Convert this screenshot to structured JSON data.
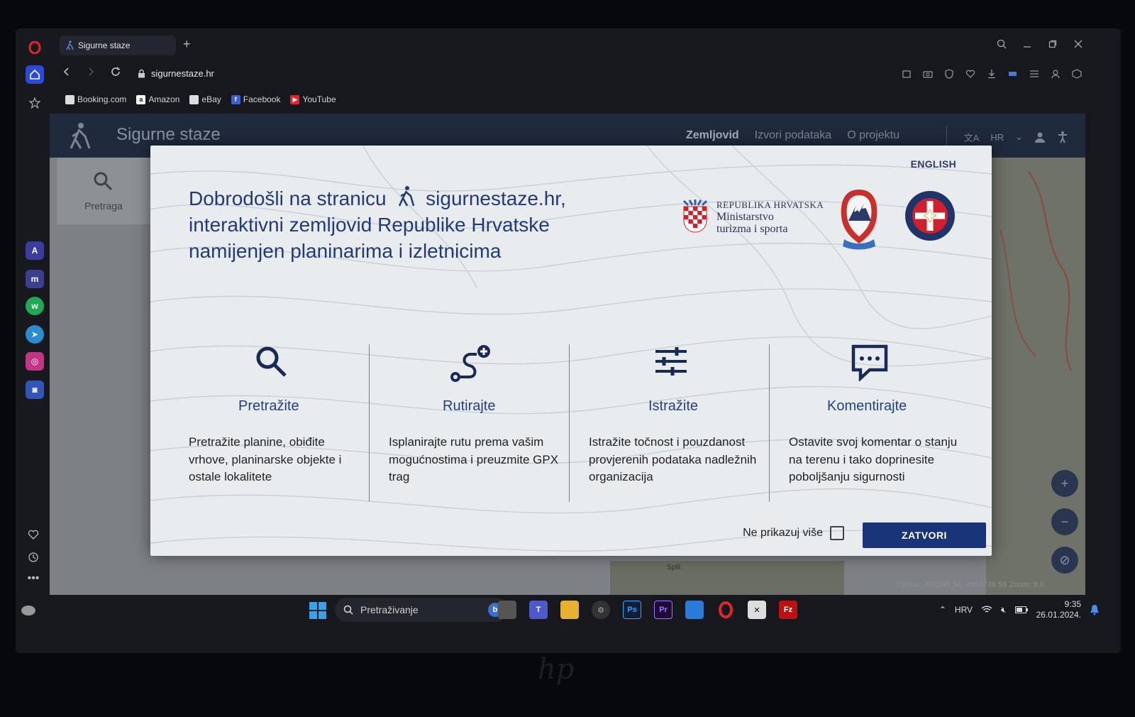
{
  "browser": {
    "tab_title": "Sigurne staze",
    "new_tab_label": "+",
    "url": "sigurnestaze.hr",
    "bookmarks": [
      {
        "label": "Booking.com",
        "icon": "page-icon"
      },
      {
        "label": "Amazon",
        "icon": "amazon-icon"
      },
      {
        "label": "eBay",
        "icon": "page-icon"
      },
      {
        "label": "Facebook",
        "icon": "facebook-icon"
      },
      {
        "label": "YouTube",
        "icon": "youtube-icon"
      }
    ]
  },
  "site": {
    "title": "Sigurne staze",
    "nav": [
      "Zemljovid",
      "Izvori podataka",
      "O projektu"
    ],
    "language": "HR",
    "left_panel_label": "Pretraga",
    "coords_text": "Centar: 495295.36, 4956738.59 Zoom: 8.0",
    "map_label": "Split"
  },
  "modal": {
    "english_link": "ENGLISH",
    "welcome_part1": "Dobrodošli na stranicu",
    "welcome_site": "sigurnestaze.hr,",
    "welcome_line2": "interaktivni zemljovid Republike Hrvatske",
    "welcome_line3": "namijenjen planinarima i izletnicima",
    "ministry": {
      "line1": "REPUBLIKA HRVATSKA",
      "line2": "Ministarstvo",
      "line3": "turizma i sporta"
    },
    "features": [
      {
        "icon": "search-icon",
        "title": "Pretražite",
        "desc": "Pretražite planine, obiđite vrhove, planinarske objekte i ostale lokalitete"
      },
      {
        "icon": "route-add-icon",
        "title": "Rutirajte",
        "desc": "Isplanirajte rutu prema vašim mogućnostima i preuzmite GPX trag"
      },
      {
        "icon": "sliders-icon",
        "title": "Istražite",
        "desc": "Istražite točnost i pouzdanost provjerenih podataka nadležnih organizacija"
      },
      {
        "icon": "comment-icon",
        "title": "Komentirajte",
        "desc": "Ostavite svoj komentar o stanju na terenu i tako doprinesite poboljšanju sigurnosti"
      }
    ],
    "dont_show_label": "Ne prikazuj više",
    "dont_show_checked": false,
    "close_label": "ZATVORI"
  },
  "taskbar": {
    "search_placeholder": "Pretraživanje",
    "language": "HRV",
    "time": "9:35",
    "date": "26.01.2024."
  },
  "colors": {
    "modal_bg": "#e9ecef",
    "title_blue": "#223a7a",
    "button_blue": "#1a347a",
    "site_header": "#1f2a3c"
  }
}
